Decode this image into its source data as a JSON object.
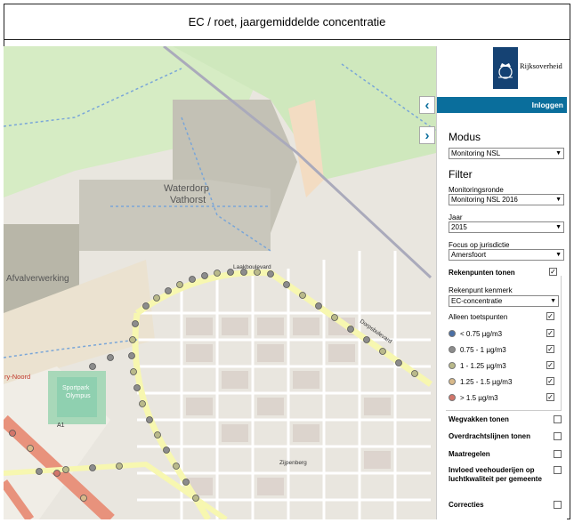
{
  "title": "EC / roet, jaargemiddelde concentratie",
  "brand": "Rijksoverheid",
  "login_label": "Inloggen",
  "modus": {
    "heading": "Modus",
    "value": "Monitoring NSL"
  },
  "filter": {
    "heading": "Filter",
    "monitoringsronde_label": "Monitoringsronde",
    "monitoringsronde_value": "Monitoring NSL 2016",
    "jaar_label": "Jaar",
    "jaar_value": "2015",
    "focus_label": "Focus op jurisdictie",
    "focus_value": "Amersfoort"
  },
  "rekenpunten": {
    "label": "Rekenpunten tonen",
    "kenmerk_label": "Rekenpunt kenmerk",
    "kenmerk_value": "EC-concentratie",
    "alleen_label": "Alleen toetspunten",
    "classes": [
      {
        "label": "< 0.75 µg/m3",
        "color": "#4a6fa5"
      },
      {
        "label": "0.75 - 1 µg/m3",
        "color": "#8c8c8c"
      },
      {
        "label": "1 - 1.25 µg/m3",
        "color": "#b9b98a"
      },
      {
        "label": "1.25 - 1.5 µg/m3",
        "color": "#d8b98a"
      },
      {
        "label": "> 1.5 µg/m3",
        "color": "#d2756a"
      }
    ]
  },
  "layers": [
    "Wegvakken tonen",
    "Overdrachtslijnen tonen",
    "Maatregelen",
    "Invloed veehouderijen op luchtkwaliteit per gemeente",
    "Correcties"
  ],
  "map_labels": {
    "waterdorp": "Waterdorp",
    "vathorst": "Vathorst",
    "afvalverwerking": "Afvalverwerking",
    "sportpark": "Sportpark",
    "olympus": "Olympus",
    "ry_noord": "ry-Noord",
    "a1": "A1",
    "laakboulevard": "Laakboulevard",
    "zijpenberg": "Zijpenberg",
    "dorpsbulevard": "Dorpsbulevard"
  },
  "icons": {
    "collapse_left": "chevron-left-icon",
    "collapse_right": "chevron-right-icon"
  }
}
